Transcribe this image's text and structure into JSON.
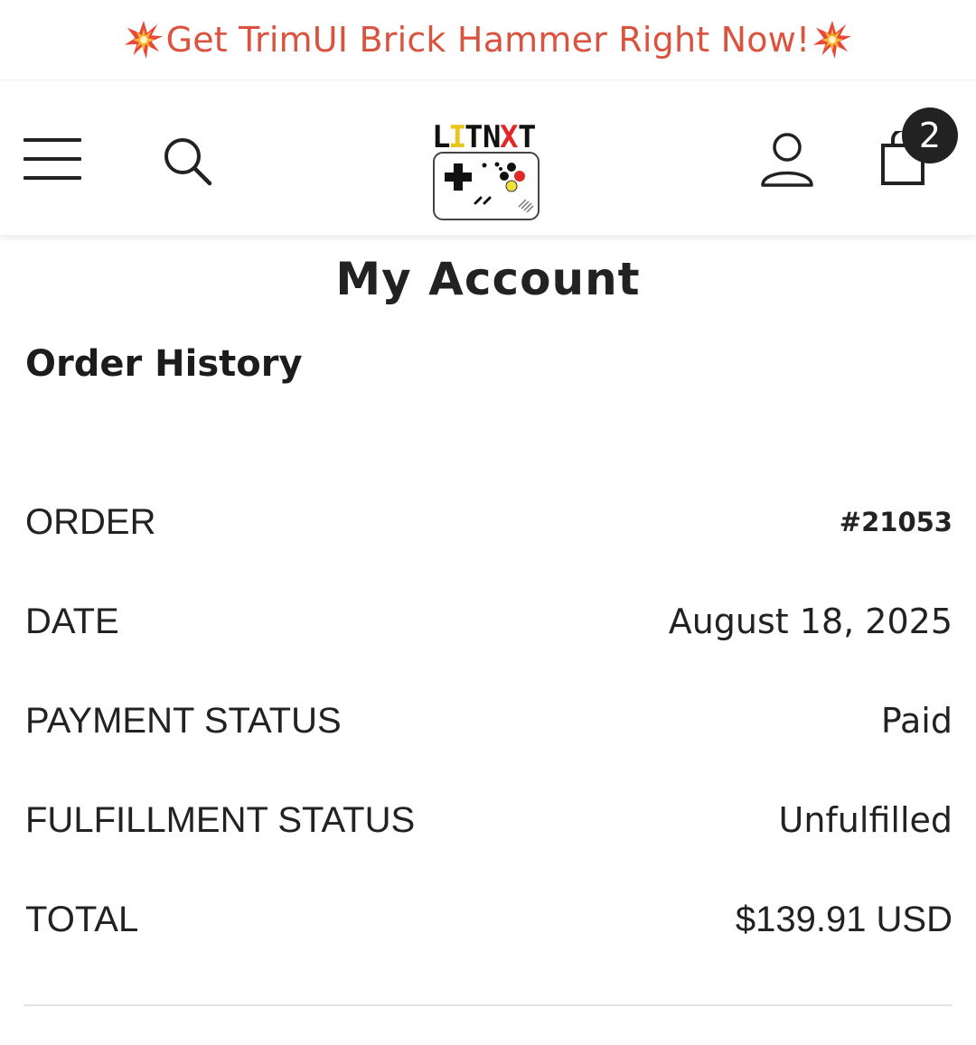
{
  "announcement": {
    "text": "Get TrimUI Brick Hammer Right Now!",
    "icon": "collision-burst-icon",
    "color": "#d9533f"
  },
  "header": {
    "menu_icon": "hamburger-menu-icon",
    "search_icon": "search-icon",
    "logo_text": "LITNXT",
    "account_icon": "account-icon",
    "cart_icon": "shopping-bag-icon",
    "cart_count": "2"
  },
  "page": {
    "title": "My Account",
    "section_title": "Order History"
  },
  "order": {
    "rows": [
      {
        "label": "ORDER",
        "value": "#21053"
      },
      {
        "label": "DATE",
        "value": "August 18, 2025"
      },
      {
        "label": "PAYMENT STATUS",
        "value": "Paid"
      },
      {
        "label": "FULFILLMENT STATUS",
        "value": "Unfulfilled"
      },
      {
        "label": "TOTAL",
        "value": "$139.91 USD"
      }
    ]
  }
}
